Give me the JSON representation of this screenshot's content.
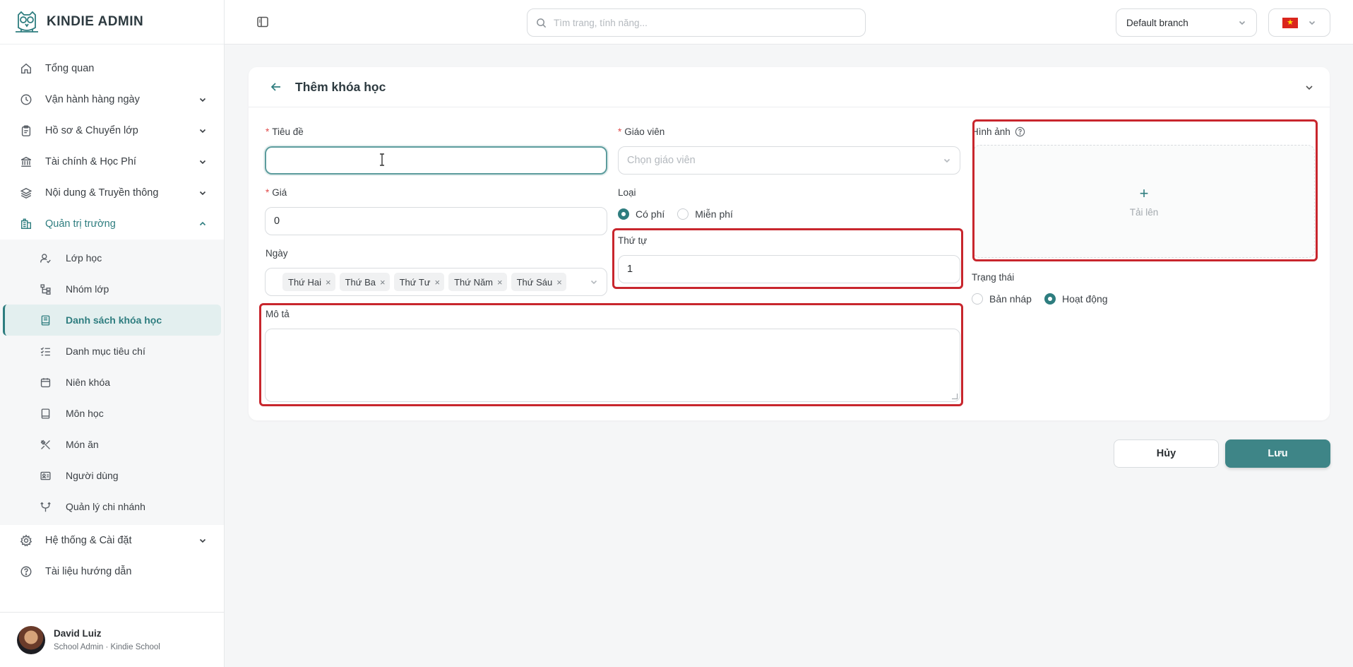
{
  "brand": {
    "name": "KINDIE ADMIN"
  },
  "sidebar": {
    "items": [
      {
        "label": "Tổng quan",
        "icon": "home-icon"
      },
      {
        "label": "Vận hành hàng ngày",
        "icon": "clock-icon",
        "expandable": true
      },
      {
        "label": "Hồ sơ & Chuyển lớp",
        "icon": "clipboard-icon",
        "expandable": true
      },
      {
        "label": "Tài chính & Học Phí",
        "icon": "bank-icon",
        "expandable": true
      },
      {
        "label": "Nội dung & Truyền thông",
        "icon": "layers-icon",
        "expandable": true
      },
      {
        "label": "Quản trị trường",
        "icon": "building-icon",
        "expandable": true,
        "open": true
      }
    ],
    "subitems": [
      {
        "label": "Lớp học",
        "icon": "user-check-icon"
      },
      {
        "label": "Nhóm lớp",
        "icon": "tree-icon"
      },
      {
        "label": "Danh sách khóa học",
        "icon": "book-icon",
        "active": true
      },
      {
        "label": "Danh mục tiêu chí",
        "icon": "list-check-icon"
      },
      {
        "label": "Niên khóa",
        "icon": "calendar-icon"
      },
      {
        "label": "Môn học",
        "icon": "notebook-icon"
      },
      {
        "label": "Món ăn",
        "icon": "utensils-icon"
      },
      {
        "label": "Người dùng",
        "icon": "id-card-icon"
      },
      {
        "label": "Quản lý chi nhánh",
        "icon": "branch-icon"
      }
    ],
    "bottom_items": [
      {
        "label": "Hệ thống & Cài đặt",
        "icon": "gear-icon",
        "expandable": true
      },
      {
        "label": "Tài liệu hướng dẫn",
        "icon": "help-icon"
      }
    ]
  },
  "user": {
    "name": "David Luiz",
    "role": "School Admin · Kindie School"
  },
  "topbar": {
    "search_placeholder": "Tìm trang, tính năng...",
    "branch": "Default branch",
    "language_flag": "vn-flag-icon"
  },
  "form": {
    "title": "Thêm khóa học",
    "title_field": {
      "label": "Tiêu đề",
      "value": ""
    },
    "teacher": {
      "label": "Giáo viên",
      "placeholder": "Chọn giáo viên"
    },
    "price": {
      "label": "Giá",
      "value": "0"
    },
    "type": {
      "label": "Loại",
      "options": [
        "Có phí",
        "Miễn phí"
      ],
      "selected": "Có phí"
    },
    "days": {
      "label": "Ngày",
      "tags": [
        "Thứ Hai",
        "Thứ Ba",
        "Thứ Tư",
        "Thứ Năm",
        "Thứ Sáu"
      ]
    },
    "order": {
      "label": "Thứ tự",
      "value": "1"
    },
    "description": {
      "label": "Mô tả",
      "value": ""
    },
    "image": {
      "label": "Hình ảnh",
      "upload_label": "Tải lên"
    },
    "status": {
      "label": "Trạng thái",
      "options": [
        "Bản nháp",
        "Hoạt động"
      ],
      "selected": "Hoạt động"
    },
    "cancel_label": "Hủy",
    "save_label": "Lưu"
  },
  "colors": {
    "accent": "#2e7d7f",
    "save_button": "#3e8587",
    "highlight": "#c8262d",
    "required": "#e14a4a"
  }
}
